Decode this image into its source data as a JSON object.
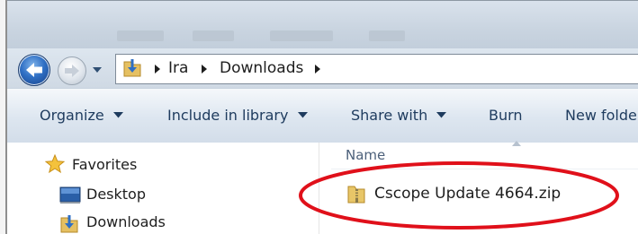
{
  "address": {
    "crumbs": [
      "Ira",
      "Downloads"
    ]
  },
  "toolbar": {
    "organize": "Organize",
    "include_in_library": "Include in library",
    "share_with": "Share with",
    "burn": "Burn",
    "new_folder": "New folde"
  },
  "navpane": {
    "favorites": "Favorites",
    "items": [
      "Desktop",
      "Downloads"
    ]
  },
  "filelist": {
    "column_name": "Name",
    "files": [
      {
        "name": "Cscope Update 4664.zip",
        "icon": "zip-folder-icon"
      }
    ]
  },
  "annotation": {
    "color": "#e0101a"
  }
}
